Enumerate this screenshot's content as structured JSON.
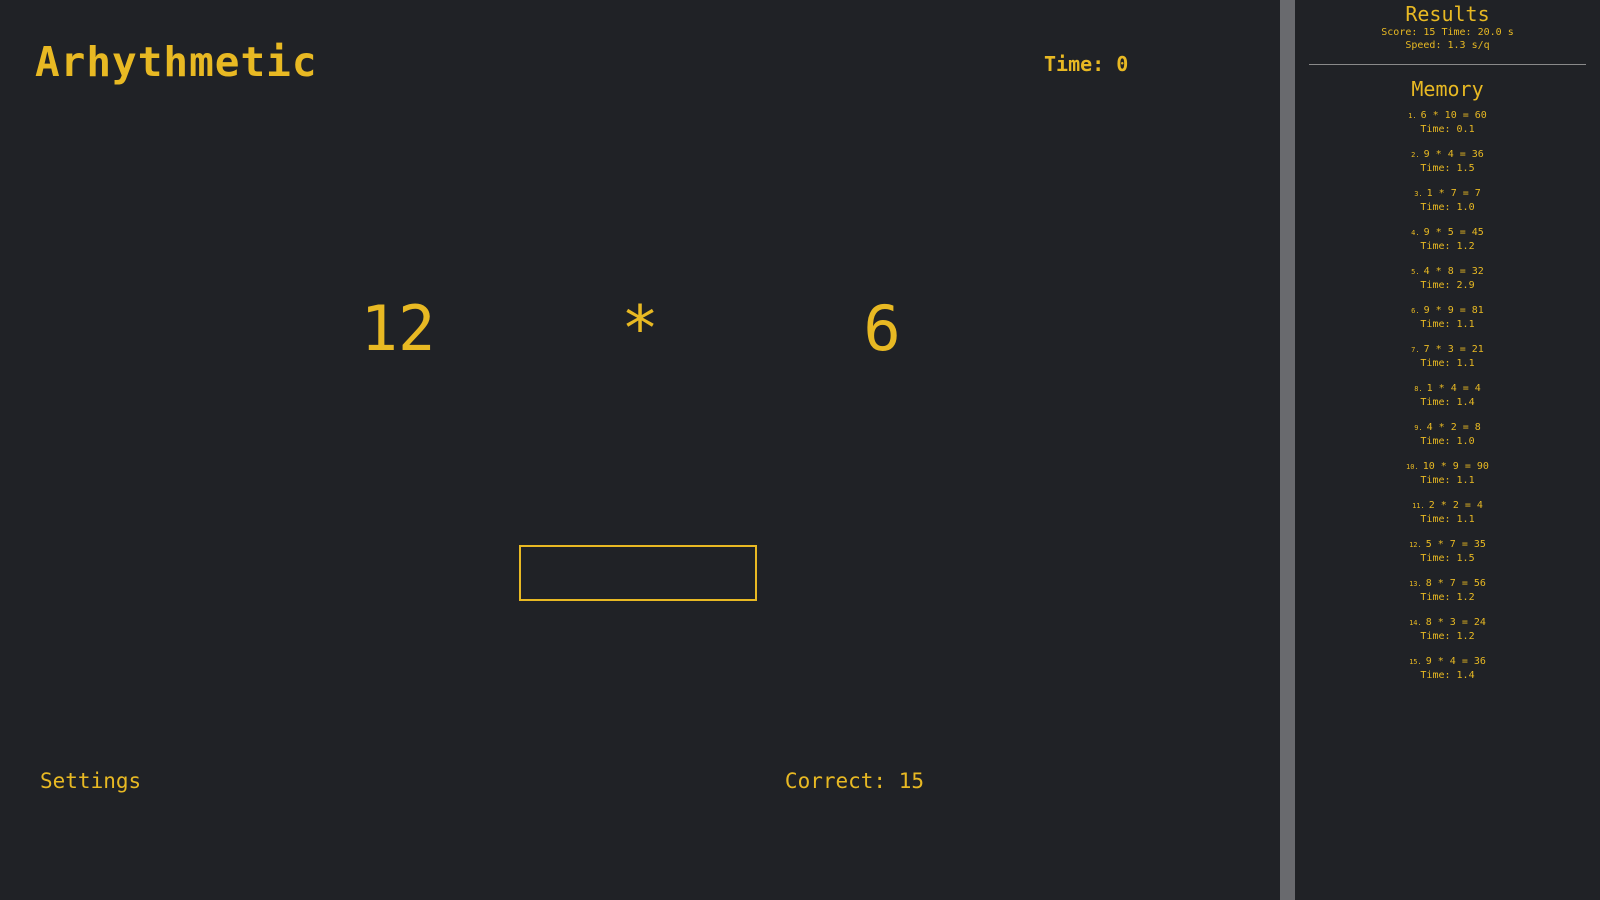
{
  "app": {
    "title": "Arhythmetic",
    "timer": "Time: 0"
  },
  "problem": {
    "left": "12",
    "operator": "*",
    "right": "6",
    "answer_value": ""
  },
  "footer": {
    "settings_label": "Settings",
    "correct_label": "Correct: 15"
  },
  "results": {
    "title": "Results",
    "summary": "Score: 15 Time: 20.0 s",
    "speed": "Speed: 1.3 s/q"
  },
  "memory": {
    "title": "Memory",
    "items": [
      {
        "num": "1.",
        "equation": "6 * 10 = 60",
        "time": "Time: 0.1"
      },
      {
        "num": "2.",
        "equation": "9 * 4 = 36",
        "time": "Time: 1.5"
      },
      {
        "num": "3.",
        "equation": "1 * 7 = 7",
        "time": "Time: 1.0"
      },
      {
        "num": "4.",
        "equation": "9 * 5 = 45",
        "time": "Time: 1.2"
      },
      {
        "num": "5.",
        "equation": "4 * 8 = 32",
        "time": "Time: 2.9"
      },
      {
        "num": "6.",
        "equation": "9 * 9 = 81",
        "time": "Time: 1.1"
      },
      {
        "num": "7.",
        "equation": "7 * 3 = 21",
        "time": "Time: 1.1"
      },
      {
        "num": "8.",
        "equation": "1 * 4 = 4",
        "time": "Time: 1.4"
      },
      {
        "num": "9.",
        "equation": "4 * 2 = 8",
        "time": "Time: 1.0"
      },
      {
        "num": "10.",
        "equation": "10 * 9 = 90",
        "time": "Time: 1.1"
      },
      {
        "num": "11.",
        "equation": "2 * 2 = 4",
        "time": "Time: 1.1"
      },
      {
        "num": "12.",
        "equation": "5 * 7 = 35",
        "time": "Time: 1.5"
      },
      {
        "num": "13.",
        "equation": "8 * 7 = 56",
        "time": "Time: 1.2"
      },
      {
        "num": "14.",
        "equation": "8 * 3 = 24",
        "time": "Time: 1.2"
      },
      {
        "num": "15.",
        "equation": "9 * 4 = 36",
        "time": "Time: 1.4"
      }
    ]
  },
  "colors": {
    "background": "#202226",
    "accent": "#e8b923",
    "divider": "#696a6e"
  }
}
